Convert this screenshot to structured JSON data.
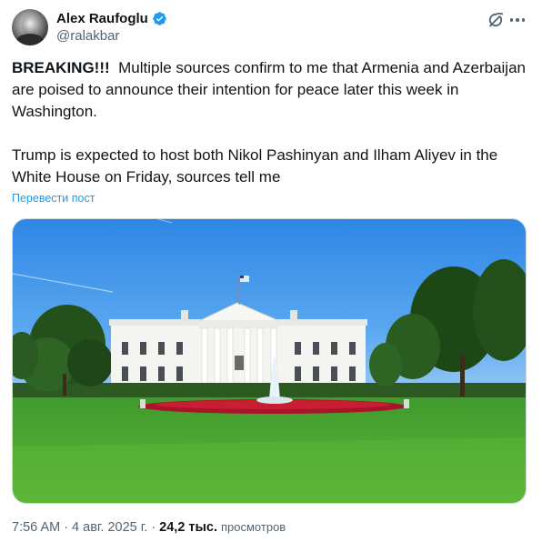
{
  "author": {
    "display_name": "Alex Raufoglu",
    "handle": "@ralakbar",
    "verified": true,
    "verified_color": "#1d9bf0"
  },
  "actions": {
    "grok_icon": "grok-icon",
    "more_icon": "more-icon"
  },
  "tweet": {
    "breaking": "BREAKING!!!",
    "paragraph1_rest": "  Multiple sources confirm to me that Armenia and Azerbaijan are poised to announce their intention for peace later this week in Washington.",
    "paragraph2": "Trump is expected to host both Nikol Pashinyan and Ilham Aliyev in the White House on Friday, sources tell me",
    "translate_label": "Перевести пост"
  },
  "media": {
    "image_icon": "white-house-photo"
  },
  "meta": {
    "time": "7:56 AM",
    "sep1": "·",
    "date": "4 авг. 2025 г.",
    "sep2": "·",
    "views_count": "24,2 тыс.",
    "views_label": "просмотров"
  },
  "colors": {
    "link": "#1d9bf0",
    "secondary_text": "#536471",
    "primary_text": "#0f1419"
  }
}
